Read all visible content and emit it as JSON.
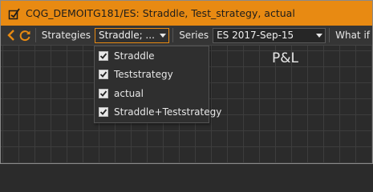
{
  "window": {
    "title": "CQG_DEMOITG181/ES: Straddle, Test_strategy, actual"
  },
  "toolbar": {
    "strategies_label": "Strategies",
    "strategies_value": "Straddle; ...",
    "series_label": "Series",
    "series_value": "ES 2017-Sep-15",
    "whatif_label": "What if"
  },
  "strategies_dropdown": {
    "items": [
      {
        "label": "Straddle",
        "checked": true
      },
      {
        "label": "Teststrategy",
        "checked": true
      },
      {
        "label": "actual",
        "checked": true
      },
      {
        "label": "Straddle+Teststrategy",
        "checked": true
      }
    ]
  },
  "chart": {
    "title": "P&L"
  },
  "colors": {
    "accent": "#e88a12",
    "background": "#2b2b2b",
    "toolbar": "#353535"
  },
  "icons": [
    "chart-edit-icon",
    "back-arrow-icon",
    "refresh-icon",
    "dropdown-arrow-icon",
    "checkbox-checked-icon"
  ]
}
